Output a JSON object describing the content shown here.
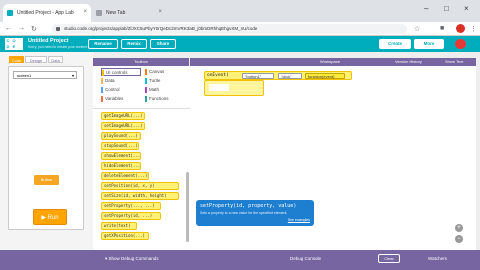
{
  "browser": {
    "tabs": [
      {
        "title": "Untitled Project - App Lab"
      },
      {
        "title": "New Tab"
      }
    ],
    "url": "studio.code.org/projects/applab/ZlJXC5uPbyY0rQeDc2mVRK3aB_j0bmDRhhqEhgvXM_nU/code",
    "colors": {
      "tabbar": "#dee1e6"
    }
  },
  "app": {
    "logo_letters": [
      "C",
      "O",
      "D",
      "E",
      "",
      "",
      ""
    ],
    "project_title": "Untitled Project",
    "project_subtitle": "Sorry, you need to create your content to save",
    "buttons": {
      "rename": "Rename",
      "remix": "Remix",
      "share": "Share",
      "create": "Create",
      "more": "More"
    },
    "accent": "#00adbc",
    "purple": "#7665a0"
  },
  "left": {
    "modes": [
      "Code",
      "Design",
      "Data"
    ],
    "screen_dropdown": "screen1",
    "phone_button": "Button",
    "run": "Run"
  },
  "toolbox": {
    "header": "Toolbox",
    "categories": [
      {
        "label": "UI controls",
        "color": "#ffc400"
      },
      {
        "label": "Canvas",
        "color": "#ff7a00"
      },
      {
        "label": "Data",
        "color": "#ffb74d"
      },
      {
        "label": "Turtle",
        "color": "#00bcd4"
      },
      {
        "label": "Control",
        "color": "#4fa0ff"
      },
      {
        "label": "Math",
        "color": "#ab47bc"
      },
      {
        "label": "Variables",
        "color": "#ff7043"
      },
      {
        "label": "Functions",
        "color": "#26a69a"
      }
    ],
    "blocks": [
      "getImageURL(...)",
      "setImageURL(...)",
      "playSound(...)",
      "stopSound(...)",
      "showElement(...)",
      "hideElement(...)",
      "deleteElement(...)",
      "setPosition(id, x, y)",
      "setSize(id, width, height)",
      "setProperty(..., ...)",
      "setProperty(id, ...)",
      "write(text)",
      "getXPosition(...)"
    ]
  },
  "workspace": {
    "header": "Workspace",
    "version_history": "Version History",
    "show_text": "Show Text",
    "block": {
      "keyword": "onEvent(",
      "arg1": "\"button1\"",
      "arg2": "\"click\"",
      "arg3": "function(event)"
    },
    "tooltip": {
      "signature": "setProperty(id, property, value)",
      "description": "Sets a property to a new value for the specified element.",
      "link": "See examples"
    }
  },
  "debug": {
    "show_commands": "Show Debug Commands",
    "console": "Debug Console",
    "clear": "Clear",
    "watchers": "Watchers"
  }
}
